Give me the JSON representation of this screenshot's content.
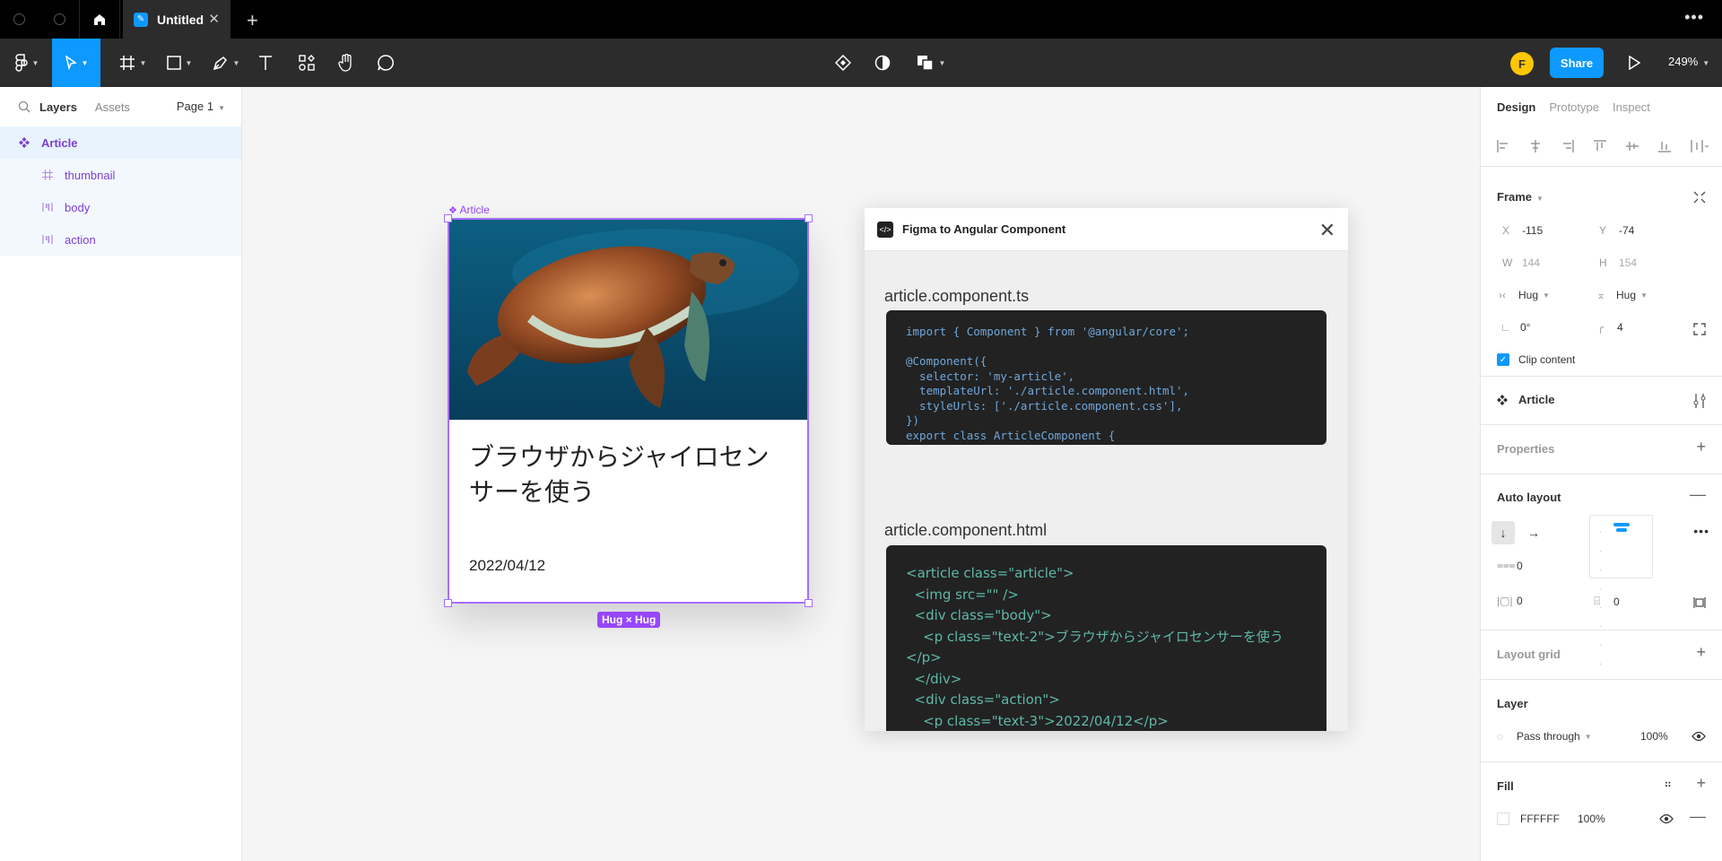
{
  "titlebar": {
    "tab_name": "Untitled"
  },
  "toolbar": {
    "share_label": "Share",
    "zoom": "249%",
    "avatar_initial": "F"
  },
  "left_panel": {
    "tabs": [
      "Layers",
      "Assets"
    ],
    "page": "Page 1",
    "layers": [
      {
        "name": "Article",
        "icon": "component-icon"
      },
      {
        "name": "thumbnail",
        "icon": "frame-icon"
      },
      {
        "name": "body",
        "icon": "autolayout-icon"
      },
      {
        "name": "action",
        "icon": "autolayout-icon"
      }
    ]
  },
  "canvas": {
    "frame_label": "Article",
    "card_title": "ブラウザからジャイロセンサーを使う",
    "card_date": "2022/04/12",
    "hug_badge": "Hug × Hug"
  },
  "plugin": {
    "title": "Figma to Angular Component",
    "ts_file": "article.component.ts",
    "ts_code": "import { Component } from '@angular/core';\n\n@Component({\n  selector: 'my-article',\n  templateUrl: './article.component.html',\n  styleUrls: ['./article.component.css'],\n})\nexport class ArticleComponent {\n}",
    "html_file": "article.component.html",
    "html_code": "<article class=\"article\">\n  <img src=\"\" />\n  <div class=\"body\">\n    <p class=\"text-2\">ブラウザからジャイロセンサーを使う\n</p>\n  </div>\n  <div class=\"action\">\n    <p class=\"text-3\">2022/04/12</p>"
  },
  "right_panel": {
    "tabs": [
      "Design",
      "Prototype",
      "Inspect"
    ],
    "frame": {
      "title": "Frame",
      "x_label": "X",
      "x": "-115",
      "y_label": "Y",
      "y": "-74",
      "w_label": "W",
      "w": "144",
      "h_label": "H",
      "h": "154",
      "hug_w": "Hug",
      "hug_h": "Hug",
      "rotation": "0°",
      "radius": "4",
      "clip_label": "Clip content"
    },
    "component_name": "Article",
    "properties_label": "Properties",
    "auto_layout": {
      "title": "Auto layout",
      "gap": "0",
      "pad_h": "0",
      "pad_v": "0"
    },
    "layout_grid_label": "Layout grid",
    "layer": {
      "title": "Layer",
      "blend": "Pass through",
      "opacity": "100%"
    },
    "fill": {
      "title": "Fill",
      "hex": "FFFFFF",
      "opacity": "100%"
    }
  }
}
